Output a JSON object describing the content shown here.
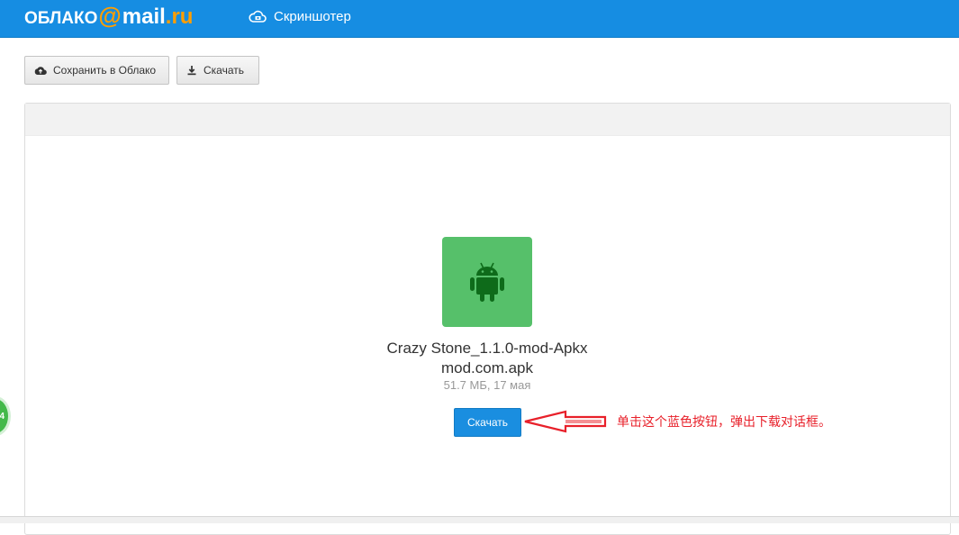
{
  "header": {
    "logo": {
      "part1": "ОБЛАКО",
      "at": "@",
      "part2": "mail",
      "part3": ".ru"
    },
    "screenshoter_label": "Скриншотер"
  },
  "toolbar": {
    "save_label": "Сохранить в Облако",
    "download_label": "Скачать"
  },
  "file": {
    "icon": "android-icon",
    "name_line1": "Crazy Stone_1.1.0-mod-Apkx",
    "name_line2": "mod.com.apk",
    "meta": "51.7 МБ, 17 мая",
    "download_button": "Скачать"
  },
  "annotation": {
    "text": "单击这个蓝色按钮，弹出下载对话框。",
    "color": "#e8202a"
  },
  "colors": {
    "header_bg": "#168de2",
    "accent_orange": "#ff9e00",
    "file_icon_bg": "#56c06a",
    "primary_button": "#1a8ee0"
  }
}
